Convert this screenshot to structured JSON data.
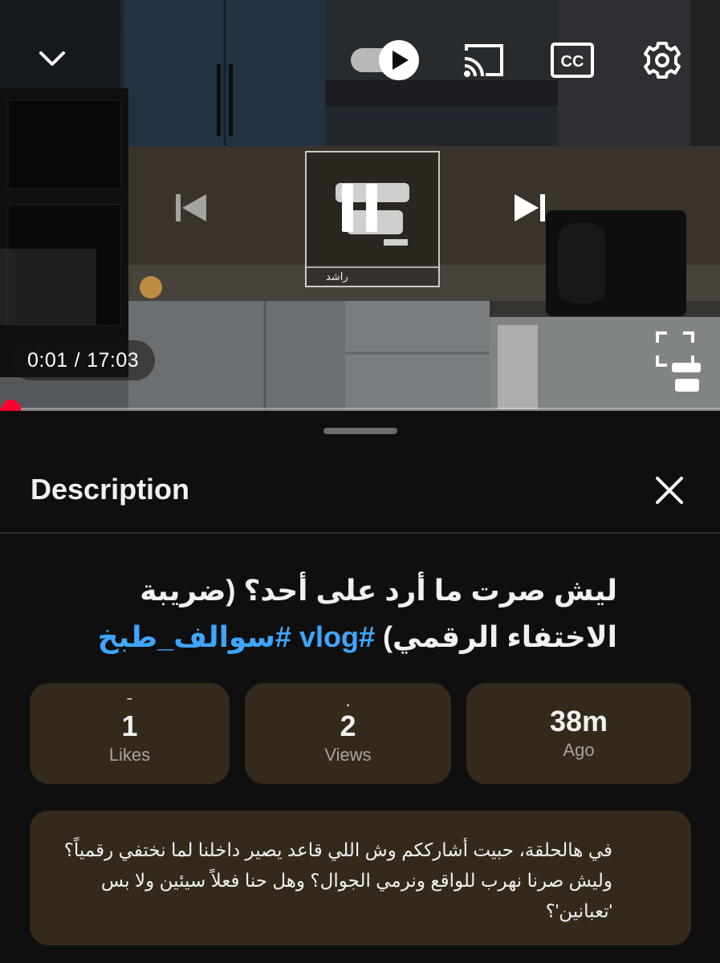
{
  "player": {
    "time_current": "0:01",
    "time_separator": "/",
    "time_total": "17:03",
    "progress_fraction": 0.002,
    "watermark_name": "راشد",
    "icons": {
      "collapse": "chevron-down-icon",
      "autoplay": "autoplay-toggle-icon",
      "cast": "cast-icon",
      "captions": "closed-captions-icon",
      "settings": "gear-icon",
      "previous": "skip-previous-icon",
      "pause": "pause-icon",
      "next": "skip-next-icon",
      "fullscreen": "fullscreen-icon"
    },
    "accent_color": "#ff0033"
  },
  "sheet": {
    "title": "Description",
    "close_icon": "close-icon",
    "video_title_text": "ليش صرت ما أرد على أحد؟ (ضريبة الاختفاء الرقمي)",
    "hashtags": [
      "#vlog",
      "#سوالف_طبخ"
    ],
    "hashtag_color": "#3ea6ff",
    "stats": [
      {
        "value": "1",
        "label": "Likes"
      },
      {
        "value": "2",
        "label": "Views"
      },
      {
        "value": "38m",
        "label": "Ago"
      }
    ],
    "description": "في هالحلقة، حبيت أشارككم وش اللي قاعد يصير داخلنا لما نختفي رقمياً؟ وليش صرنا نهرب للواقع ونرمي الجوال؟ وهل حنا فعلاً سيئين ولا بس 'تعبانين'؟",
    "card_color": "#332a1c"
  }
}
